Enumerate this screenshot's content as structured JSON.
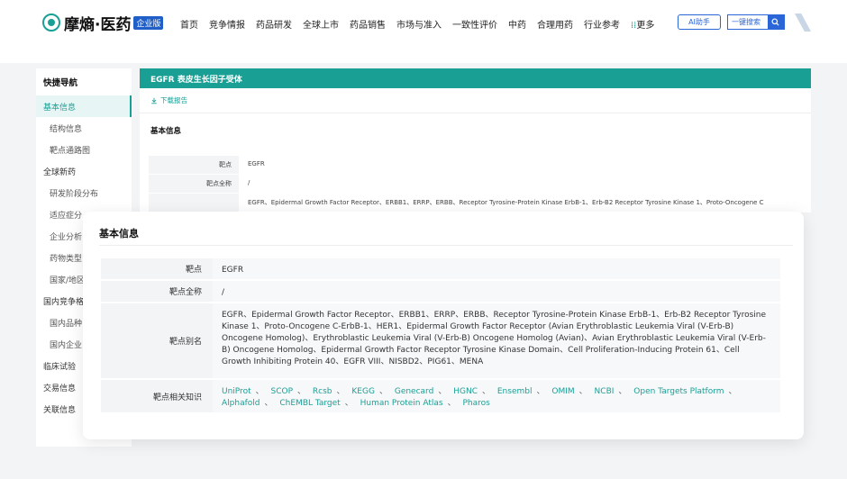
{
  "header": {
    "logo_text": "摩熵·医药",
    "logo_badge": "企业版",
    "nav": [
      "首页",
      "竞争情报",
      "药品研发",
      "全球上市",
      "药品销售",
      "市场与准入",
      "一致性评价",
      "中药",
      "合理用药",
      "行业参考"
    ],
    "more_label": "更多",
    "ai_label": "AI助手",
    "search_label": "一键搜索"
  },
  "sidebar": {
    "title": "快捷导航",
    "items": [
      {
        "label": "基本信息",
        "level": 1,
        "active": true
      },
      {
        "label": "结构信息",
        "level": 2
      },
      {
        "label": "靶点通路图",
        "level": 2
      },
      {
        "label": "全球新药",
        "level": 1
      },
      {
        "label": "研发阶段分布",
        "level": 2
      },
      {
        "label": "适应症分",
        "level": 2
      },
      {
        "label": "企业分析",
        "level": 2
      },
      {
        "label": "药物类型",
        "level": 2
      },
      {
        "label": "国家/地区",
        "level": 2
      },
      {
        "label": "国内竞争格",
        "level": 1
      },
      {
        "label": "国内品种",
        "level": 2
      },
      {
        "label": "国内企业",
        "level": 2
      },
      {
        "label": "临床试验",
        "level": 1
      },
      {
        "label": "交易信息",
        "level": 1
      },
      {
        "label": "关联信息",
        "level": 1
      }
    ]
  },
  "main": {
    "target_bar": "EGFR  表皮生长因子受体",
    "download_label": "下载报告",
    "section_title": "基本信息",
    "rows": [
      {
        "label": "靶点",
        "value": "EGFR"
      },
      {
        "label": "靶点全称",
        "value": "/"
      },
      {
        "label": "",
        "value": "EGFR、Epidermal Growth Factor Receptor、ERBB1、ERRP、ERBB、Receptor Tyrosine-Protein Kinase ErbB-1、Erb-B2 Receptor Tyrosine Kinase 1、Proto-Oncogene C"
      }
    ]
  },
  "card": {
    "title": "基本信息",
    "target_label": "靶点",
    "target_value": "EGFR",
    "fullname_label": "靶点全称",
    "fullname_value": "/",
    "alias_label": "靶点别名",
    "alias_value": "EGFR、Epidermal Growth Factor Receptor、ERBB1、ERRP、ERBB、Receptor Tyrosine-Protein Kinase ErbB-1、Erb-B2 Receptor Tyrosine Kinase 1、Proto-Oncogene C-ErbB-1、HER1、Epidermal Growth Factor Receptor (Avian Erythroblastic Leukemia Viral (V-Erb-B) Oncogene Homolog)、Erythroblastic Leukemia Viral (V-Erb-B) Oncogene Homolog (Avian)、Avian Erythroblastic Leukemia Viral (V-Erb-B) Oncogene Homolog、Epidermal Growth Factor Receptor Tyrosine Kinase Domain、Cell Proliferation-Inducing Protein 61、Cell Growth Inhibiting Protein 40、EGFR VIII、NISBD2、PIG61、MENA",
    "knowledge_label": "靶点相关知识",
    "links": [
      "UniProt",
      "SCOP",
      "Rcsb",
      "KEGG",
      "Genecard",
      "HGNC",
      "Ensembl",
      "OMIM",
      "NCBI",
      "Open Targets Platform",
      "Alphafold",
      "ChEMBL Target",
      "Human Protein Atlas",
      "Pharos"
    ]
  },
  "colors": {
    "accent": "#1a9f95",
    "brand_blue": "#2b66d9"
  }
}
